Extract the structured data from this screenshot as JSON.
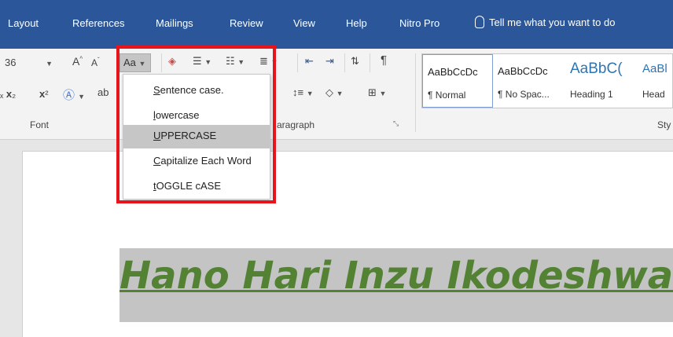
{
  "tabs": [
    "Layout",
    "References",
    "Mailings",
    "Review",
    "View",
    "Help",
    "Nitro Pro"
  ],
  "tell_me": "Tell me what you want to do",
  "ribbon": {
    "font_size": "36",
    "change_case_label": "Aa",
    "font_group_label": "Font",
    "paragraph_group_label": "aragraph",
    "styles_group_label": "Sty",
    "font_grow": "A",
    "font_shrink": "A"
  },
  "styles": [
    {
      "sample": "AaBbCcDc",
      "name": "¶ Normal"
    },
    {
      "sample": "AaBbCcDc",
      "name": "¶ No Spac..."
    },
    {
      "sample": "AaBbC(",
      "name": "Heading 1"
    },
    {
      "sample": "AaBl",
      "name": "Head"
    }
  ],
  "case_menu": [
    {
      "accel": "S",
      "rest": "entence case."
    },
    {
      "accel": "l",
      "rest": "owercase"
    },
    {
      "accel": "U",
      "rest": "PPERCASE"
    },
    {
      "accel": "C",
      "rest": "apitalize Each Word"
    },
    {
      "accel": "t",
      "rest": "OGGLE cASE"
    }
  ],
  "document": {
    "heading_text": "Hano Hari Inzu Ikodeshwa"
  },
  "colors": {
    "tabbar": "#2b579a",
    "heading": "#548235",
    "highlight_box": "#e8141c"
  }
}
